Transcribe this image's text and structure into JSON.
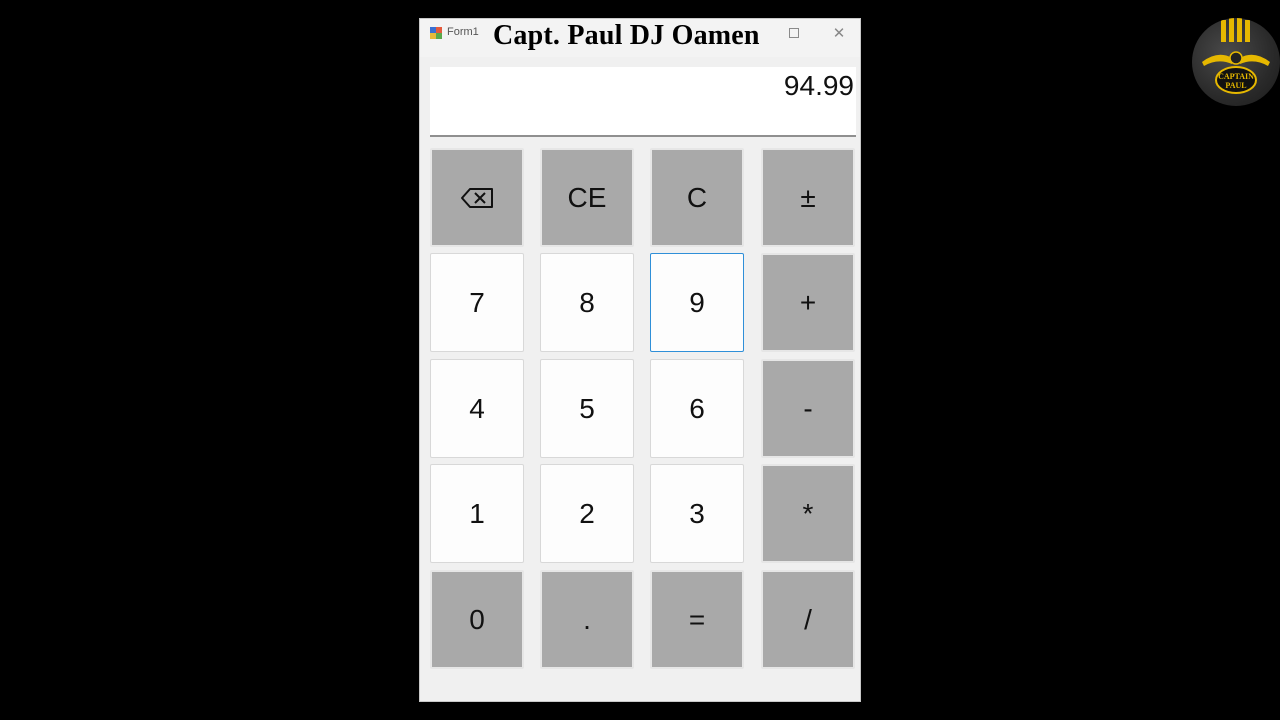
{
  "window": {
    "form_title": "Form1",
    "overlay_title": "Capt. Paul DJ Oamen",
    "minimize_label": "",
    "close_label": "✕"
  },
  "display": {
    "value": "94.99"
  },
  "keypad": {
    "rows": [
      [
        {
          "label": "",
          "name": "backspace-button",
          "style": "gray",
          "icon": "backspace-icon"
        },
        {
          "label": "CE",
          "name": "clear-entry-button",
          "style": "gray"
        },
        {
          "label": "C",
          "name": "clear-button",
          "style": "gray"
        },
        {
          "label": "±",
          "name": "negate-button",
          "style": "gray"
        }
      ],
      [
        {
          "label": "7",
          "name": "digit-7-button",
          "style": "white"
        },
        {
          "label": "8",
          "name": "digit-8-button",
          "style": "white"
        },
        {
          "label": "9",
          "name": "digit-9-button",
          "style": "white",
          "focused": true
        },
        {
          "label": "+",
          "name": "add-button",
          "style": "gray"
        }
      ],
      [
        {
          "label": "4",
          "name": "digit-4-button",
          "style": "white"
        },
        {
          "label": "5",
          "name": "digit-5-button",
          "style": "white"
        },
        {
          "label": "6",
          "name": "digit-6-button",
          "style": "white"
        },
        {
          "label": "-",
          "name": "subtract-button",
          "style": "gray"
        }
      ],
      [
        {
          "label": "1",
          "name": "digit-1-button",
          "style": "white"
        },
        {
          "label": "2",
          "name": "digit-2-button",
          "style": "white"
        },
        {
          "label": "3",
          "name": "digit-3-button",
          "style": "white"
        },
        {
          "label": "*",
          "name": "multiply-button",
          "style": "gray"
        }
      ],
      [
        {
          "label": "0",
          "name": "digit-0-button",
          "style": "gray"
        },
        {
          "label": ".",
          "name": "decimal-button",
          "style": "gray"
        },
        {
          "label": "=",
          "name": "equals-button",
          "style": "gray"
        },
        {
          "label": "/",
          "name": "divide-button",
          "style": "gray"
        }
      ]
    ]
  },
  "logo": {
    "text": "CAPTAIN PAUL",
    "icon": "captain-paul-logo"
  },
  "colors": {
    "background": "#000000",
    "window": "#f0f0f0",
    "key_gray": "#a9a9a9",
    "key_white": "#fdfdfd",
    "focus": "#2f8fd8",
    "logo_gold": "#e6b800"
  }
}
